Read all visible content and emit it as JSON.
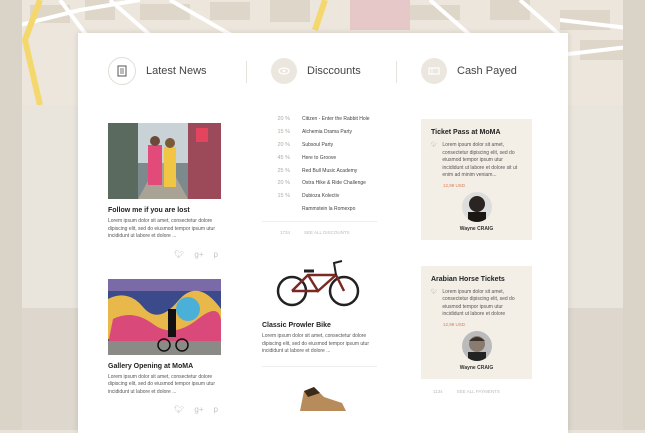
{
  "colors": {
    "accent": "#d87a55",
    "icon_bg": "#ebe6de",
    "icon_fg": "#8b847a",
    "ticket_bg": "#f3efe7"
  },
  "header": {
    "news": {
      "label": "Latest News",
      "icon": "document-icon"
    },
    "discounts": {
      "label": "Disccounts",
      "icon": "eye-icon"
    },
    "cash": {
      "label": "Cash Payed",
      "icon": "ticket-icon"
    }
  },
  "news": [
    {
      "title": "Follow me if you are lost",
      "body": "Lorem ipsum dolor sit amet, consectetur dolore dipiscing elit, sed do eiusmod tempor ipsum utur incididunt ut labore et dolore ..."
    },
    {
      "title": "Gallery Opening at MoMA",
      "body": "Lorem ipsum dolor sit amet, consectetur dolore dipiscing elit, sed do eiusmod tempor ipsum utur incididunt ut labore et dolore ..."
    }
  ],
  "social_icons": [
    "twitter-icon",
    "google-plus-icon",
    "pinterest-icon"
  ],
  "discounts": {
    "items": [
      {
        "pct": "20 %",
        "name": "Citizen - Enter the Rabbit Hole"
      },
      {
        "pct": "15 %",
        "name": "Alchemia Drama Party"
      },
      {
        "pct": "20 %",
        "name": "Subsoul Party"
      },
      {
        "pct": "45 %",
        "name": "Here to Groove"
      },
      {
        "pct": "25 %",
        "name": "Red Bull Music Academy"
      },
      {
        "pct": "20 %",
        "name": "Ostra Hike & Ride Challenge"
      },
      {
        "pct": "15 %",
        "name": "Dubioza Kolectiv"
      },
      {
        "pct": "",
        "name": "Rammstein la Romexpo"
      }
    ],
    "count": "1734",
    "see_all": "SEE ALL DISCOUNTS"
  },
  "product": {
    "title": "Classic Prowler Bike",
    "body": "Lorem ipsum dolor sit amet, consectetur dolore dipiscing elit, sed do eiusmod tempor ipsum utur incididunt ut labore et dolore ..."
  },
  "tickets": [
    {
      "title": "Ticket Pass at MoMA",
      "body": "Lorem ipsum dolor sit amet, consectetur dipiscing elit, sed do eiusmod tempor ipsum utur incididunt ut labore et dolore sit ut enim ad minim veniam...",
      "price": "12,99 USD",
      "person": "Wayne CRAIG"
    },
    {
      "title": "Arabian Horse Tickets",
      "body": "Lorem ipsum dolor sit amet, consectetur dipiscing elit, sed do eiusmod tempor ipsum utur incididunt ut labore et dolore",
      "price": "12,99 USD",
      "person": "Wayne CRAIG"
    }
  ],
  "payments": {
    "count": "1134",
    "see_all": "SEE ALL PAYMENTS"
  }
}
